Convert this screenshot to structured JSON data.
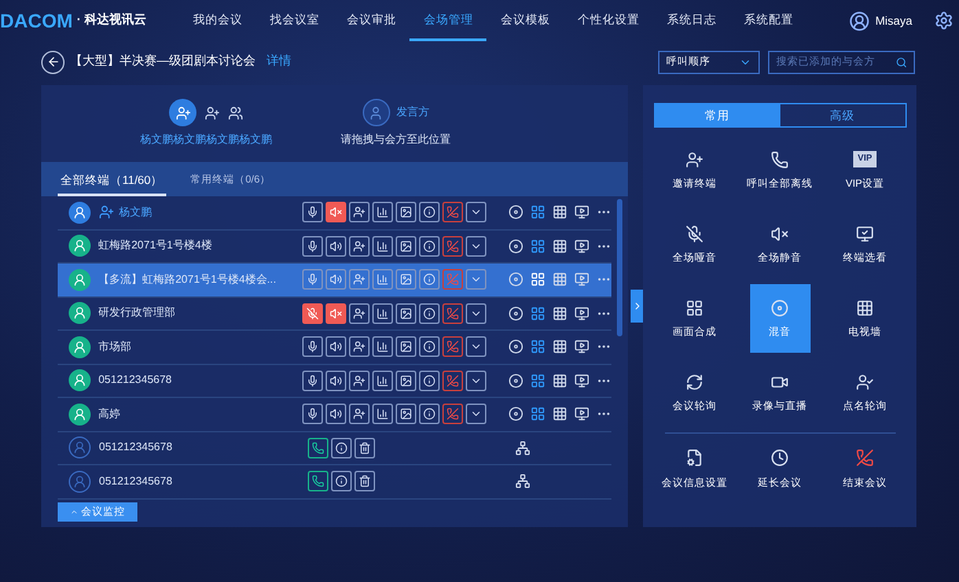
{
  "brand": {
    "logo": "DACOM",
    "name": "· 科达视讯云"
  },
  "nav": [
    {
      "label": "我的会议",
      "selected": false
    },
    {
      "label": "找会议室",
      "selected": false
    },
    {
      "label": "会议审批",
      "selected": false
    },
    {
      "label": "会场管理",
      "selected": true
    },
    {
      "label": "会议模板",
      "selected": false
    },
    {
      "label": "个性化设置",
      "selected": false
    },
    {
      "label": "系统日志",
      "selected": false
    },
    {
      "label": "系统配置",
      "selected": false
    }
  ],
  "user": {
    "name": "Misaya"
  },
  "conference": {
    "title": "【大型】半决赛—级团剧本讨论会",
    "details_link": "详情"
  },
  "call_order": {
    "value": "呼叫顺序"
  },
  "search": {
    "placeholder": "搜索已添加的与会方"
  },
  "chair": {
    "name": "杨文鹏杨文鹏杨文鹏杨文鹏"
  },
  "speaker": {
    "title": "发言方",
    "hint": "请拖拽与会方至此位置"
  },
  "list_tabs": [
    {
      "label": "全部终端（11/60）",
      "selected": true
    },
    {
      "label": "常用终端（0/6）",
      "selected": false
    }
  ],
  "terminals": [
    {
      "name": "杨文鹏",
      "kind": "online",
      "chair": true,
      "selected": false,
      "mic_muted": false,
      "speaker_muted": true
    },
    {
      "name": "虹梅路2071号1号楼4楼",
      "kind": "online",
      "chair": false,
      "selected": false,
      "mic_muted": false,
      "speaker_muted": false
    },
    {
      "name": "【多流】虹梅路2071号1号楼4楼会...",
      "kind": "online",
      "chair": false,
      "selected": true,
      "mic_muted": false,
      "speaker_muted": false
    },
    {
      "name": "研发行政管理部",
      "kind": "online",
      "chair": false,
      "selected": false,
      "mic_muted": true,
      "speaker_muted": true
    },
    {
      "name": "市场部",
      "kind": "online",
      "chair": false,
      "selected": false,
      "mic_muted": false,
      "speaker_muted": false
    },
    {
      "name": "051212345678",
      "kind": "online",
      "chair": false,
      "selected": false,
      "mic_muted": false,
      "speaker_muted": false
    },
    {
      "name": "高婷",
      "kind": "online",
      "chair": false,
      "selected": false,
      "mic_muted": false,
      "speaker_muted": false
    },
    {
      "name": "051212345678",
      "kind": "offline",
      "chair": false,
      "selected": false
    },
    {
      "name": "051212345678",
      "kind": "offline",
      "chair": false,
      "selected": false
    }
  ],
  "monitor_button": {
    "label": "会议监控"
  },
  "panel_tabs": [
    {
      "label": "常用",
      "selected": true
    },
    {
      "label": "高级",
      "selected": false
    }
  ],
  "actions": [
    {
      "label": "邀请终端",
      "selected": false
    },
    {
      "label": "呼叫全部离线",
      "selected": false
    },
    {
      "label": "VIP设置",
      "selected": false
    },
    {
      "label": "全场哑音",
      "selected": false
    },
    {
      "label": "全场静音",
      "selected": false
    },
    {
      "label": "终端选看",
      "selected": false
    },
    {
      "label": "画面合成",
      "selected": false
    },
    {
      "label": "混音",
      "selected": true
    },
    {
      "label": "电视墙",
      "selected": false
    },
    {
      "label": "会议轮询",
      "selected": false
    },
    {
      "label": "录像与直播",
      "selected": false
    },
    {
      "label": "点名轮询",
      "selected": false
    }
  ],
  "vip_badge": {
    "text": "VIP"
  },
  "meeting_actions": [
    {
      "label": "会议信息设置"
    },
    {
      "label": "延长会议"
    },
    {
      "label": "结束会议"
    }
  ]
}
